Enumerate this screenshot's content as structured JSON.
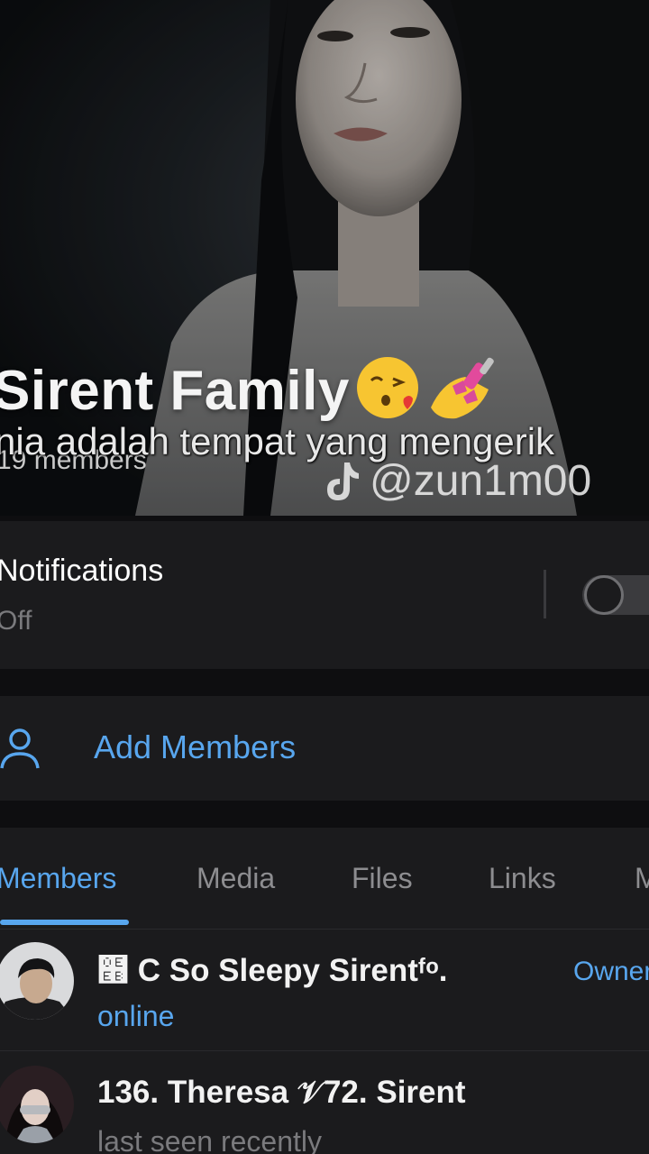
{
  "group": {
    "title": "Sirent Family",
    "title_emojis": [
      "face-blowing-kiss-emoji",
      "nail-polish-emoji"
    ],
    "member_count": "19 members",
    "overlay_caption": "nia adalah tempat yang mengerik",
    "watermark": "@zun1m00"
  },
  "notifications": {
    "label": "Notifications",
    "value": "Off",
    "enabled": false
  },
  "add_members": {
    "label": "Add Members"
  },
  "tabs": [
    {
      "label": "Members",
      "active": true
    },
    {
      "label": "Media",
      "active": false
    },
    {
      "label": "Files",
      "active": false
    },
    {
      "label": "Links",
      "active": false
    },
    {
      "label": "M",
      "active": false
    }
  ],
  "members": [
    {
      "name": "໫ C So Sleepy Sirentᶠᵒ.",
      "status": "online",
      "role": "Owner"
    },
    {
      "name": "136. Theresa 𝒱72. Sirent",
      "status": "last seen recently",
      "role": ""
    }
  ],
  "colors": {
    "accent": "#58a6ee",
    "surface": "#1b1b1d",
    "background": "#0e0e10"
  }
}
